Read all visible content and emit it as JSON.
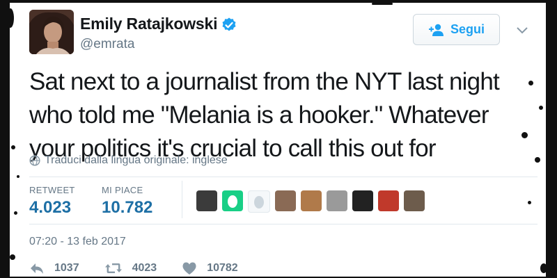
{
  "tweet": {
    "author": {
      "display_name": "Emily Ratajkowski",
      "handle": "@emrata",
      "verified": true
    },
    "follow_button": {
      "label": "Segui",
      "icon": "add-user-icon"
    },
    "more_menu_icon": "chevron-down-icon",
    "text": "Sat next to a journalist from the NYT last night who told me \"Melania is a hooker.\" Whatever your politics it's crucial to call this out for",
    "translate_link": {
      "icon": "globe-icon",
      "label": "Traduci dalla lingua originale: inglese"
    },
    "stats": {
      "retweets": {
        "label": "RETWEET",
        "value": "4.023"
      },
      "likes": {
        "label": "MI PIACE",
        "value": "10.782"
      }
    },
    "likers": [
      {
        "name": "liker-1",
        "color": "#3b3b3b"
      },
      {
        "name": "liker-2",
        "color": "#19cf86"
      },
      {
        "name": "liker-3",
        "color": "#f5f8fa"
      },
      {
        "name": "liker-4",
        "color": "#8a6a55"
      },
      {
        "name": "liker-5",
        "color": "#b07a4a"
      },
      {
        "name": "liker-6",
        "color": "#9a9a9a"
      },
      {
        "name": "liker-7",
        "color": "#222222"
      },
      {
        "name": "liker-8",
        "color": "#c0392b"
      },
      {
        "name": "liker-9",
        "color": "#6d5c4c"
      }
    ],
    "timestamp": "07:20 - 13 feb 2017",
    "actions": {
      "reply": {
        "icon": "reply-icon",
        "count": "1037"
      },
      "retweet": {
        "icon": "retweet-icon",
        "count": "4023"
      },
      "like": {
        "icon": "heart-icon",
        "count": "10782"
      }
    },
    "colors": {
      "accent": "#1da1f2",
      "stat_value": "#1d6fa5",
      "secondary_text": "#657786",
      "border": "#e1e8ed"
    }
  }
}
